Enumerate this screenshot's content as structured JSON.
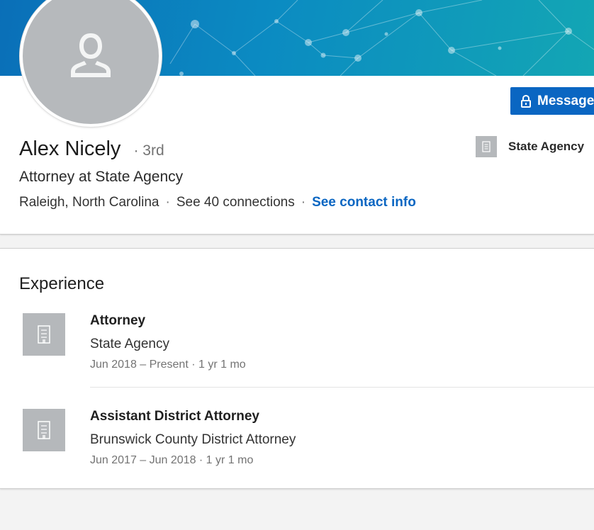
{
  "colors": {
    "primary": "#0a66c2",
    "banner_start": "#0a6fb8",
    "banner_end": "#13a6b4",
    "placeholder_gray": "#b5b8bb"
  },
  "profile": {
    "name": "Alex Nicely",
    "degree": "· 3rd",
    "headline": "Attorney at State Agency",
    "location": "Raleigh, North Carolina",
    "separator": "·",
    "connections_link": "See 40 connections",
    "contact_link": "See contact info",
    "avatar_icon": "person-placeholder-icon"
  },
  "actions": {
    "message_label": "Message",
    "message_icon": "lock-icon"
  },
  "current_company": {
    "name": "State Agency",
    "logo_icon": "building-icon"
  },
  "experience": {
    "title": "Experience",
    "items": [
      {
        "role": "Attorney",
        "company": "State Agency",
        "dates": "Jun 2018 – Present · 1 yr 1 mo",
        "logo_icon": "building-icon"
      },
      {
        "role": "Assistant District Attorney",
        "company": "Brunswick County District Attorney",
        "dates": "Jun 2017 – Jun 2018 · 1 yr 1 mo",
        "logo_icon": "building-icon"
      }
    ]
  }
}
